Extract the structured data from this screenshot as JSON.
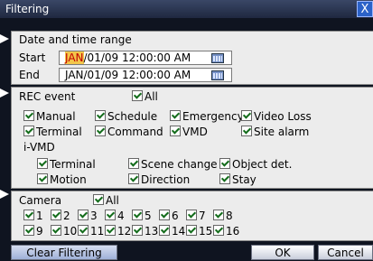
{
  "window": {
    "title": "Filtering",
    "close_glyph": "X"
  },
  "date_section": {
    "heading": "Date and time range",
    "start_label": "Start",
    "start_month": "JAN",
    "start_rest": "/01/09 12:00:00 AM",
    "end_label": "End",
    "end_value": "JAN/01/09 12:00:00 AM",
    "calendar_icon": "calendar-icon"
  },
  "rec_section": {
    "heading": "REC event",
    "all_label": "All",
    "events": [
      {
        "label": "Manual",
        "checked": true
      },
      {
        "label": "Schedule",
        "checked": true
      },
      {
        "label": "Emergency",
        "checked": true
      },
      {
        "label": "Video Loss",
        "checked": true
      },
      {
        "label": "Terminal",
        "checked": true
      },
      {
        "label": "Command",
        "checked": true
      },
      {
        "label": "VMD",
        "checked": true
      },
      {
        "label": "Site alarm",
        "checked": true
      }
    ],
    "ivmd_heading": "i-VMD",
    "ivmd": [
      {
        "label": "Terminal",
        "checked": true
      },
      {
        "label": "Scene change",
        "checked": true
      },
      {
        "label": "Object det.",
        "checked": true
      },
      {
        "label": "Motion",
        "checked": true
      },
      {
        "label": "Direction",
        "checked": true
      },
      {
        "label": "Stay",
        "checked": true
      }
    ]
  },
  "camera_section": {
    "heading": "Camera",
    "all_label": "All",
    "cameras": [
      "1",
      "2",
      "3",
      "4",
      "5",
      "6",
      "7",
      "8",
      "9",
      "10",
      "11",
      "12",
      "13",
      "14",
      "15",
      "16"
    ]
  },
  "buttons": {
    "clear": "Clear Filtering",
    "ok": "OK",
    "cancel": "Cancel"
  },
  "colors": {
    "accent": "#2b62c8",
    "highlight": "#f3c64a",
    "check": "#136c1b"
  }
}
